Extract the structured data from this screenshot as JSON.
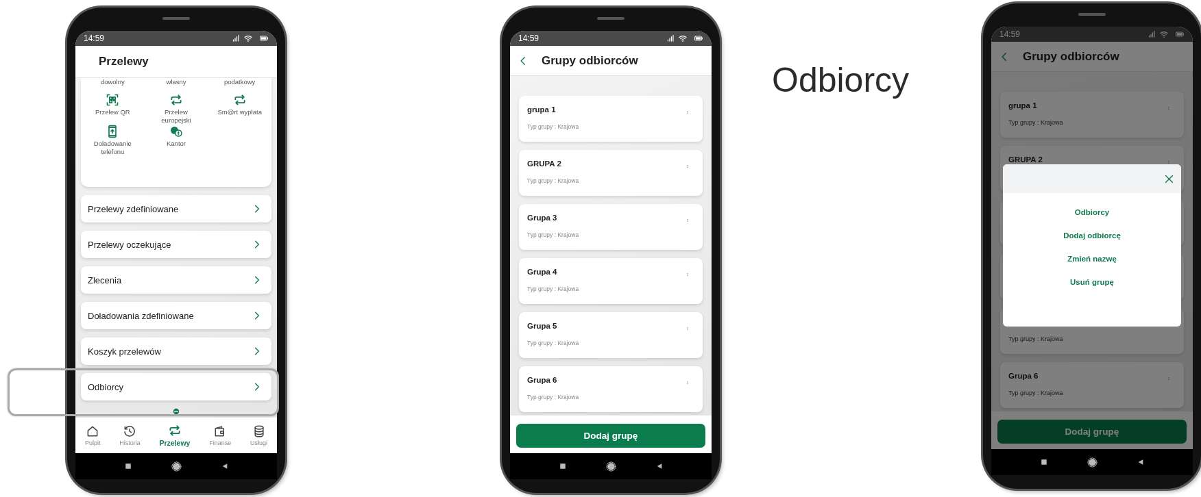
{
  "transfers_phone": {
    "kind": "transfers",
    "time": "14:59",
    "title": "Przelewy",
    "shortcuts": [
      {
        "kind": "text",
        "label": "dowolny"
      },
      {
        "kind": "text",
        "label": "własny"
      },
      {
        "kind": "text",
        "label": "podatkowy"
      },
      {
        "kind": "qr",
        "label": "Przelew QR"
      },
      {
        "kind": "arrows",
        "label": "Przelew europejski"
      },
      {
        "kind": "arrows",
        "label": "Sm@rt wypłata"
      },
      {
        "kind": "mobile",
        "label": "Doładowanie telefonu"
      },
      {
        "kind": "coins",
        "label": "Kantor"
      }
    ],
    "menu": [
      {
        "label": "Przelewy zdefiniowane",
        "highlighted": false
      },
      {
        "label": "Przelewy oczekujące",
        "highlighted": false
      },
      {
        "label": "Zlecenia",
        "highlighted": false
      },
      {
        "label": "Doładowania zdefiniowane",
        "highlighted": false
      },
      {
        "label": "Koszyk przelewów",
        "highlighted": false
      },
      {
        "label": "Odbiorcy",
        "highlighted": true
      }
    ],
    "nav": [
      {
        "kind": "home",
        "label": "Pulpit",
        "selected": false
      },
      {
        "kind": "history",
        "label": "Historia",
        "selected": false
      },
      {
        "kind": "arrows",
        "label": "Przelewy",
        "selected": true
      },
      {
        "kind": "wallet",
        "label": "Finanse",
        "selected": false
      },
      {
        "kind": "stack",
        "label": "Usługi",
        "selected": false
      }
    ]
  },
  "groups_phone": {
    "kind": "groups",
    "time": "14:59",
    "title": "Grupy odbiorców",
    "dimmed": false,
    "groups": [
      {
        "name": "grupa 1",
        "type": "Typ grupy : Krajowa"
      },
      {
        "name": "GRUPA 2",
        "type": "Typ grupy : Krajowa"
      },
      {
        "name": "Grupa 3",
        "type": "Typ grupy : Krajowa"
      },
      {
        "name": "Grupa 4",
        "type": "Typ grupy : Krajowa"
      },
      {
        "name": "Grupa 5",
        "type": "Typ grupy : Krajowa"
      },
      {
        "name": "Grupa 6",
        "type": "Typ grupy : Krajowa"
      }
    ],
    "add_button": "Dodaj grupę"
  },
  "caption": "Odbiorcy",
  "groups_menu_phone": {
    "kind": "groups",
    "time": "14:59",
    "title": "Grupy odbiorców",
    "dimmed": true,
    "groups": [
      {
        "name": "grupa 1",
        "type": "Typ grupy : Krajowa"
      },
      {
        "name": "GRUPA 2"
      },
      {
        "covered": true
      },
      {
        "covered": true
      },
      {
        "type": "Typ grupy : Krajowa"
      },
      {
        "name": "Grupa 6",
        "type": "Typ grupy : Krajowa"
      }
    ],
    "add_button": "Dodaj grupę",
    "menu": {
      "items": [
        "Odbiorcy",
        "Dodaj odbiorcę",
        "Zmień nazwę",
        "Usuń grupę"
      ]
    }
  }
}
